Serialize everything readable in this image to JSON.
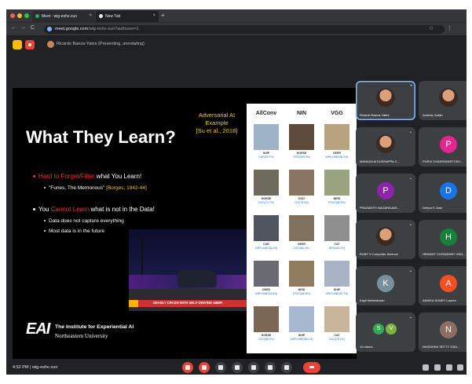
{
  "browser": {
    "tabs": [
      {
        "label": "Meet - wig-eshv-zun",
        "active": false
      },
      {
        "label": "New Tab",
        "active": true
      }
    ],
    "new_tab_label": "+",
    "url_host": "meet.google.com",
    "url_path": "/wig-eshv-zun?authuser=1",
    "nav": {
      "back": "←",
      "forward": "→",
      "reload": "C"
    }
  },
  "meet": {
    "presenter_text": "Ricardo Baeza-Yates (Presenting, annotating)",
    "meeting_time": "4:52 PM",
    "meeting_code": "wig-eshv-zun",
    "colors": {
      "hangup": "#ea4335",
      "surface": "#3c4043",
      "background": "#202124"
    }
  },
  "slide": {
    "title": "What They Learn?",
    "example_label": [
      "Adversarial AI",
      "Example",
      "[Su et al., 2018]"
    ],
    "bullets": [
      {
        "red": "Hard to Forget/Filter",
        "rest": " what You Learn!"
      },
      {
        "pre": "You ",
        "red": "Cannot Learn",
        "rest": " what is not in the Data!"
      }
    ],
    "sub1": {
      "text": "\"Funes, The Memorious\" ",
      "gold": "[Borges, 1942-44]"
    },
    "sub2": [
      "Data does not capture everything",
      "Most data is in the future"
    ],
    "news_caption": "DEADLY CRASH WITH SELF-DRIVING UBER",
    "logo": "EAI",
    "institute": "The Institute for Experiential AI",
    "university": "Northeastern University",
    "colors": {
      "accent_red": "#e53935",
      "accent_gold": "#f5c518"
    }
  },
  "grid": {
    "headers": [
      "AllConv",
      "NIN",
      "VGG"
    ],
    "rows": [
      [
        {
          "l1": "SHIP",
          "l2": "CAR(99.7%)"
        },
        {
          "l1": "HORSE",
          "l2": "FROG(99.9%)"
        },
        {
          "l1": "DEER",
          "l2": "AIRPLANE(85.3%)"
        }
      ],
      [
        {
          "l1": "HORSE",
          "l2": "DOG(70.7%)"
        },
        {
          "l1": "DOG",
          "l2": "CAT(75.5%)"
        },
        {
          "l1": "BIRD",
          "l2": "FROG(86.5%)"
        }
      ],
      [
        {
          "l1": "CAR",
          "l2": "AIRPLANE(82.4%)"
        },
        {
          "l1": "DEER",
          "l2": "DOG(86.4%)"
        },
        {
          "l1": "CAT",
          "l2": "BIRD(66.2%)"
        }
      ],
      [
        {
          "l1": "DEER",
          "l2": "AIRPLANE(49.8%)"
        },
        {
          "l1": "BIRD",
          "l2": "FROG(88.8%)"
        },
        {
          "l1": "SHIP",
          "l2": "AIRPLANE(62.7%)"
        }
      ],
      [
        {
          "l1": "HORSE",
          "l2": "DOG(88.0%)"
        },
        {
          "l1": "SHIP",
          "l2": "AIRPLANE(88.2%)"
        },
        {
          "l1": "CAT",
          "l2": "DOG(78.2%)"
        }
      ]
    ]
  },
  "participants": [
    {
      "name": "Ricardo Baeza-Yates",
      "initial": "",
      "color": "#3c4043",
      "speaking": true
    },
    {
      "name": "Andrew Judah",
      "initial": "",
      "color": "#3c4043"
    },
    {
      "name": "MANASA M KUSHAPPA C...",
      "initial": "",
      "color": "#3c4043"
    },
    {
      "name": "PURVI CHAKRAVARTI BH...",
      "initial": "P",
      "color": "#e52592"
    },
    {
      "name": "PRASANTH NAGARAJAN...",
      "initial": "P",
      "color": "#8e24aa"
    },
    {
      "name": "Deepa V Jose",
      "initial": "D",
      "color": "#1a73e8"
    },
    {
      "name": "RUBY V Computer Science",
      "initial": "",
      "color": "#3c4043"
    },
    {
      "name": "HEMANT CHOWDHRY 2361...",
      "initial": "H",
      "color": "#188038"
    },
    {
      "name": "Kapil Maheshwari",
      "initial": "K",
      "color": "#78909c"
    },
    {
      "name": "ANIKKA SUNEY Lauren",
      "initial": "A",
      "color": "#f4511e"
    },
    {
      "name": "10 others",
      "initial": "",
      "color": "#3c4043"
    },
    {
      "name": "NIVEDHINI SETTY 2361...",
      "initial": "N",
      "color": "#8d6e63"
    }
  ]
}
